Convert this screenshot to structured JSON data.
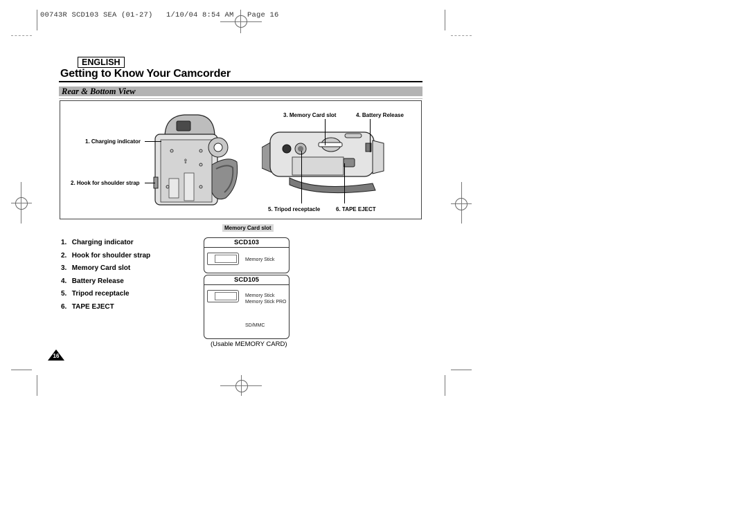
{
  "print_header": "00743R SCD103 SEA (01-27)   1/10/04 8:54 AM   Page 16",
  "language_badge": "ENGLISH",
  "page_title": "Getting to Know Your Camcorder",
  "section_title": "Rear & Bottom View",
  "figure": {
    "rear_view_callouts": [
      {
        "label": "1. Charging indicator"
      },
      {
        "label": "2. Hook for shoulder strap"
      }
    ],
    "bottom_view_callouts": [
      {
        "label": "3. Memory Card slot"
      },
      {
        "label": "4. Battery Release"
      },
      {
        "label": "5. Tripod receptacle"
      },
      {
        "label": "6. TAPE EJECT"
      }
    ]
  },
  "parts_list": [
    {
      "num": "1.",
      "label": "Charging indicator"
    },
    {
      "num": "2.",
      "label": "Hook for shoulder strap"
    },
    {
      "num": "3.",
      "label": "Memory Card slot"
    },
    {
      "num": "4.",
      "label": "Battery Release"
    },
    {
      "num": "5.",
      "label": "Tripod receptacle"
    },
    {
      "num": "6.",
      "label": "TAPE EJECT"
    }
  ],
  "memory_card_panel": {
    "heading": "Memory Card slot",
    "models": [
      {
        "model": "SCD103",
        "cards": [
          "Memory Stick"
        ]
      },
      {
        "model": "SCD105",
        "cards": [
          "Memory Stick",
          "Memory Stick PRO",
          "SD/MMC"
        ]
      }
    ],
    "caption": "(Usable MEMORY CARD)"
  },
  "page_number": "16"
}
